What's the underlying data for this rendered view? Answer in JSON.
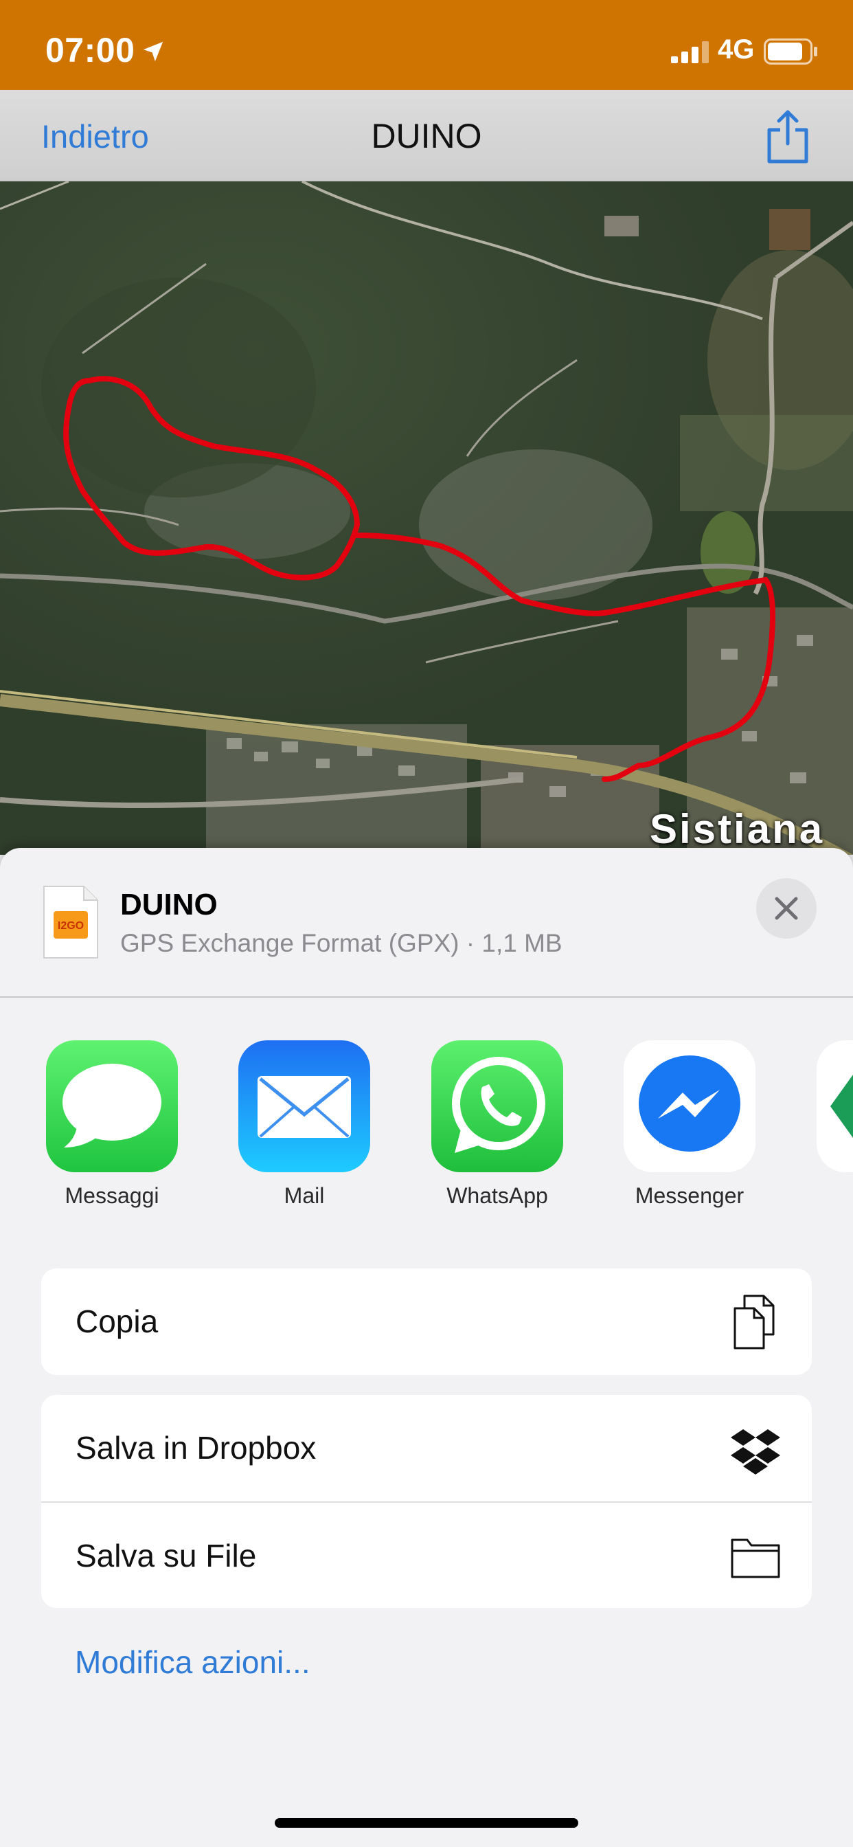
{
  "status_bar": {
    "time": "07:00",
    "network": "4G"
  },
  "nav": {
    "back_label": "Indietro",
    "title": "DUINO"
  },
  "map": {
    "place_label": "Sistiana",
    "route_color": "#e3000f"
  },
  "file": {
    "icon_text": "I2GO",
    "name": "DUINO",
    "meta": "GPS Exchange Format (GPX) · 1,1 MB"
  },
  "apps": [
    {
      "label": "Messaggi",
      "icon": "messages-icon"
    },
    {
      "label": "Mail",
      "icon": "mail-icon"
    },
    {
      "label": "WhatsApp",
      "icon": "whatsapp-icon"
    },
    {
      "label": "Messenger",
      "icon": "messenger-icon"
    }
  ],
  "actions_group1": [
    {
      "label": "Copia",
      "icon": "copy-icon"
    }
  ],
  "actions_group2": [
    {
      "label": "Salva in Dropbox",
      "icon": "dropbox-icon"
    },
    {
      "label": "Salva su File",
      "icon": "folder-icon"
    }
  ],
  "edit_actions_label": "Modifica azioni...",
  "colors": {
    "status_bar": "#cf7400",
    "link_blue": "#2f7bd6",
    "messages_green": "#34c759",
    "mail_blue": "#1e8cf5",
    "whatsapp_green": "#2bc04a",
    "messenger_blue": "#1877f2"
  }
}
